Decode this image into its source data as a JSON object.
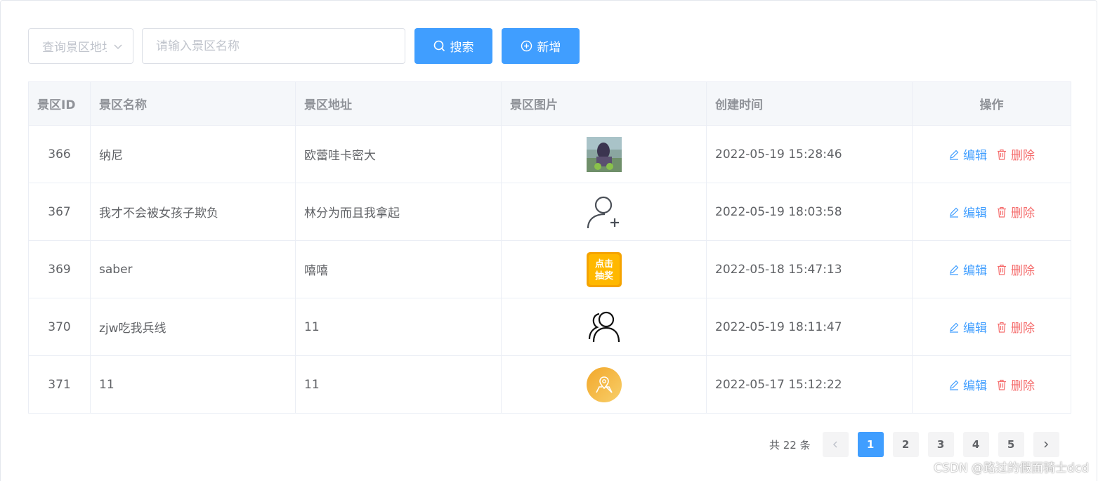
{
  "toolbar": {
    "address_select_placeholder": "查询景区地址",
    "name_input_placeholder": "请输入景区名称",
    "search_label": "搜索",
    "add_label": "新增"
  },
  "table": {
    "headers": [
      "景区ID",
      "景区名称",
      "景区地址",
      "景区图片",
      "创建时间",
      "操作"
    ],
    "rows": [
      {
        "id": "366",
        "name": "纳尼",
        "address": "欧蕾哇卡密大",
        "image": "photo-thumbnail",
        "created": "2022-05-19 15:28:46"
      },
      {
        "id": "367",
        "name": "我才不会被女孩子欺负",
        "address": "林分为而且我拿起",
        "image": "add-user-icon",
        "created": "2022-05-19 18:03:58"
      },
      {
        "id": "369",
        "name": "saber",
        "address": "嘻嘻",
        "image": "lottery-badge",
        "created": "2022-05-18 15:47:13"
      },
      {
        "id": "370",
        "name": "zjw吃我兵线",
        "address": "11",
        "image": "users-icon",
        "created": "2022-05-19 18:11:47"
      },
      {
        "id": "371",
        "name": "11",
        "address": "11",
        "image": "map-pin-badge",
        "created": "2022-05-17 15:12:22"
      }
    ],
    "edit_label": "编辑",
    "delete_label": "删除",
    "lottery_badge_text": [
      "点击",
      "抽奖"
    ]
  },
  "pagination": {
    "total_text": "共 22 条",
    "pages": [
      "1",
      "2",
      "3",
      "4",
      "5"
    ],
    "current": "1"
  },
  "watermark": "CSDN @路过的假面骑士dcd",
  "colors": {
    "primary": "#409eff",
    "danger": "#f56c6c",
    "header_bg": "#f5f7fa",
    "border": "#ebeef5"
  }
}
